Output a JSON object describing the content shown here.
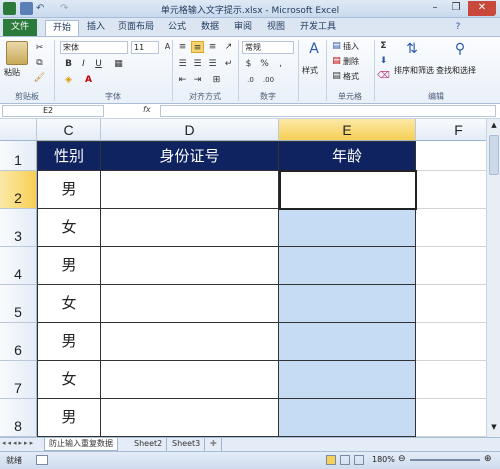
{
  "window": {
    "title": "单元格输入文字提示.xlsx - Microsoft Excel"
  },
  "tabs": {
    "file": "文件",
    "items": [
      "开始",
      "插入",
      "页面布局",
      "公式",
      "数据",
      "审阅",
      "视图",
      "开发工具"
    ]
  },
  "ribbon": {
    "paste": "粘贴",
    "font_name": "宋体",
    "font_size": "11",
    "number_format": "常规",
    "style": "样式",
    "insert": "插入",
    "delete": "删除",
    "format": "格式",
    "sum_symbol": "Σ",
    "sort_filter": "排序和筛选",
    "find_select": "查找和选择",
    "groups": {
      "clipboard": "剪贴板",
      "font": "字体",
      "alignment": "对齐方式",
      "number": "数字",
      "cells": "单元格",
      "editing": "编辑"
    }
  },
  "formula_bar": {
    "name_box": "E2",
    "fx": "fx",
    "formula": ""
  },
  "grid": {
    "columns": [
      "C",
      "D",
      "E",
      "F"
    ],
    "rows": [
      "1",
      "2",
      "3",
      "4",
      "5",
      "6",
      "7",
      "8"
    ],
    "headers": {
      "C": "性别",
      "D": "身份证号",
      "E": "年龄"
    },
    "genders": [
      "男",
      "女",
      "男",
      "女",
      "男",
      "女",
      "男"
    ]
  },
  "sheets": {
    "names": [
      "防止输入重复数据",
      "Sheet2",
      "Sheet3"
    ]
  },
  "status": {
    "ready": "就绪",
    "zoom": "180%"
  },
  "colors": {
    "header_fill": "#0e2360",
    "validation_fill": "#c6dcf5",
    "file_tab": "#2b7a3b"
  }
}
